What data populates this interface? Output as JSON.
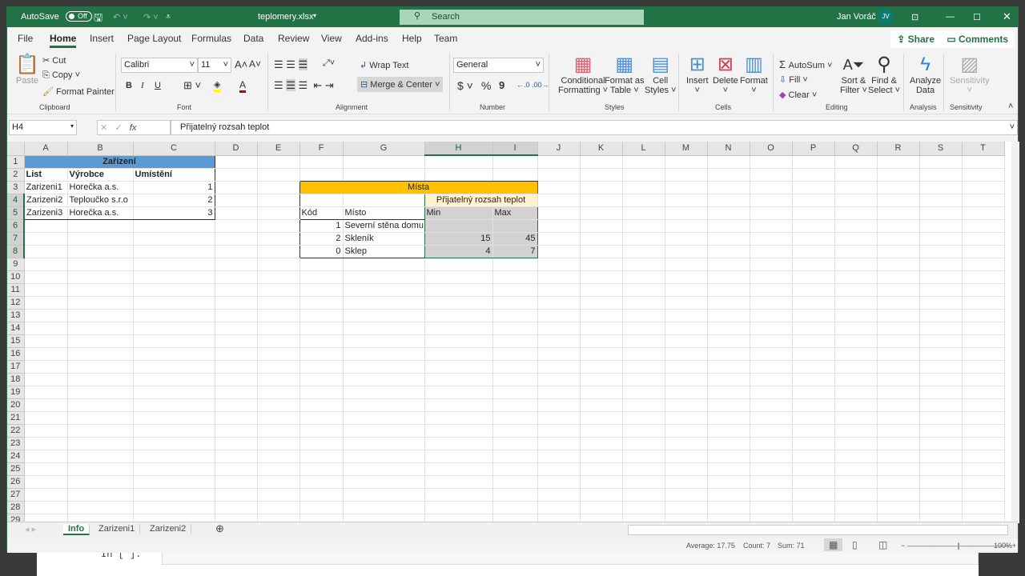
{
  "title": {
    "autosave": "AutoSave",
    "autosave_state": "Off",
    "filename": "teplomery.xlsx",
    "search": "Search",
    "user": "Jan Voráč",
    "initials": "JV"
  },
  "tabs": [
    "File",
    "Home",
    "Insert",
    "Page Layout",
    "Formulas",
    "Data",
    "Review",
    "View",
    "Add-ins",
    "Help",
    "Team"
  ],
  "active_tab": "Home",
  "share": "Share",
  "comments": "Comments",
  "ribbon": {
    "clipboard": {
      "paste": "Paste",
      "cut": "Cut",
      "copy": "Copy",
      "format_painter": "Format Painter",
      "label": "Clipboard"
    },
    "font": {
      "name": "Calibri",
      "size": "11",
      "bold": "B",
      "italic": "I",
      "underline": "U",
      "label": "Font"
    },
    "alignment": {
      "wrap": "Wrap Text",
      "merge": "Merge & Center",
      "label": "Alignment"
    },
    "number": {
      "format": "General",
      "currency": "$",
      "percent": "%",
      "comma": "9",
      "label": "Number"
    },
    "styles": {
      "conditional": [
        "Conditional",
        "Formatting ˅"
      ],
      "format_table": [
        "Format as",
        "Table ˅"
      ],
      "cell_styles": [
        "Cell",
        "Styles ˅"
      ],
      "label": "Styles"
    },
    "cells": {
      "insert": "Insert",
      "delete": "Delete",
      "format": "Format",
      "label": "Cells"
    },
    "editing": {
      "autosum": "AutoSum",
      "fill": "Fill",
      "clear": "Clear",
      "sort": [
        "Sort &",
        "Filter ˅"
      ],
      "find": [
        "Find &",
        "Select ˅"
      ],
      "label": "Editing"
    },
    "analysis": {
      "analyze": [
        "Analyze",
        "Data"
      ],
      "label": "Analysis"
    },
    "sensitivity": {
      "button": "Sensitivity",
      "label": "Sensitivity"
    }
  },
  "formula_bar": {
    "name_box": "H4",
    "content": "Přijatelný rozsah teplot"
  },
  "columns": [
    "A",
    "B",
    "C",
    "D",
    "E",
    "F",
    "G",
    "H",
    "I",
    "J",
    "K",
    "L",
    "M",
    "N",
    "O",
    "P",
    "Q",
    "R",
    "S",
    "T"
  ],
  "row_count": 29,
  "cells": {
    "A1": "Zařízení",
    "A2": "List",
    "B2": "Výrobce",
    "C2": "Umístění",
    "A3": "Zarizeni1",
    "B3": "Horečka a.s.",
    "C3": "1",
    "A4": "Zarizeni2",
    "B4": "Teploučko s.r.o",
    "C4": "2",
    "A5": "Zarizeni3",
    "B5": "Horečka a.s.",
    "C5": "3",
    "F3": "Místa",
    "H4": "Přijatelný rozsah teplot",
    "F5": "Kód",
    "G5": "Místo",
    "H5": "Min",
    "I5": "Max",
    "F6": "1",
    "G6": "Severní stěna domu",
    "F7": "2",
    "G7": "Skleník",
    "H7": "15",
    "I7": "45",
    "F8": "0",
    "G8": "Sklep",
    "H8": "4",
    "I8": "7"
  },
  "colors": {
    "zarizeni_header": "#5b9bd5",
    "mista_header": "#ffc000",
    "range_header": "#fff2cc",
    "selection": "#d2d2d2",
    "brand": "#217346"
  },
  "sheets": [
    "Info",
    "Zarizeni1",
    "Zarizeni2"
  ],
  "active_sheet": "Info",
  "status": {
    "average": "Average: 17.75",
    "count": "Count: 7",
    "sum": "Sum: 71",
    "zoom": "100%"
  }
}
